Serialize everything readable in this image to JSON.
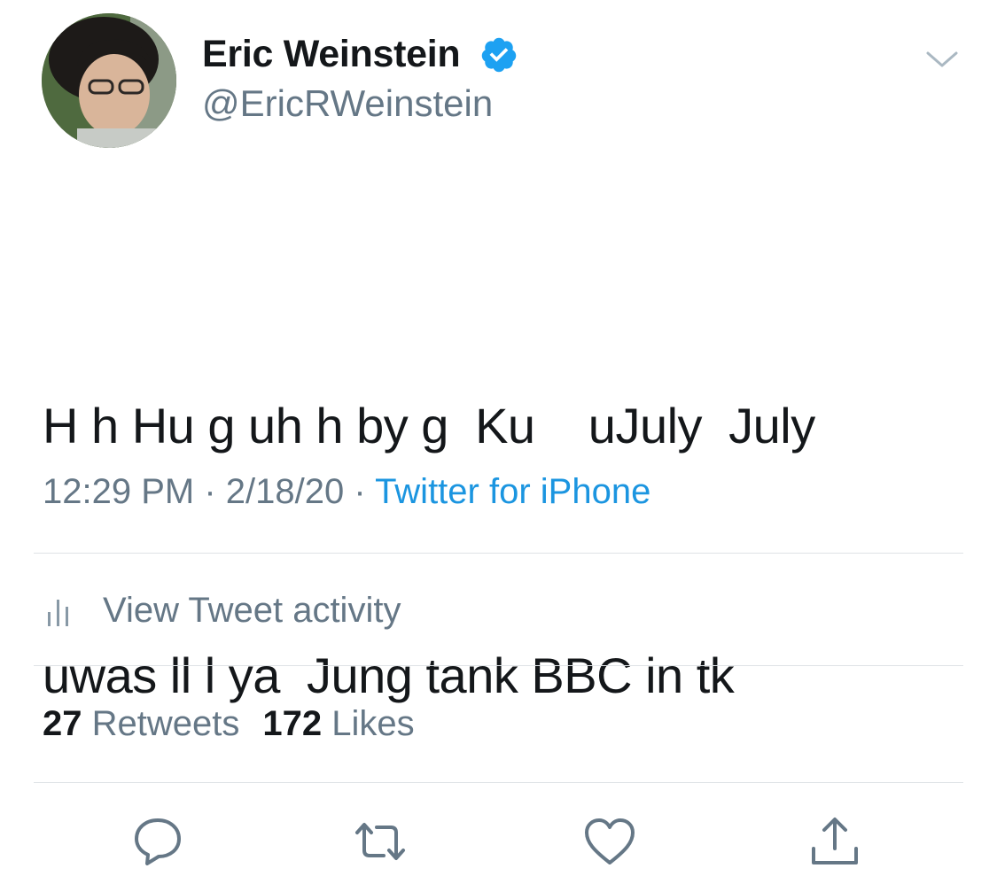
{
  "author": {
    "display_name": "Eric Weinstein",
    "handle": "@EricRWeinstein",
    "verified": true
  },
  "tweet": {
    "text_line1": "H h Hu g uh h by g  Ku    uJuly  July",
    "text_line2": "uwas ll l ya  Jung tank BBC in tk"
  },
  "meta": {
    "time": "12:29 PM",
    "sep1": " · ",
    "date": "2/18/20",
    "sep2": " · ",
    "source": "Twitter for iPhone"
  },
  "activity": {
    "label": "View Tweet activity"
  },
  "stats": {
    "retweets_count": "27",
    "retweets_label": "Retweets",
    "likes_count": "172",
    "likes_label": "Likes"
  },
  "icons": {
    "verified": "verified-badge-icon",
    "caret": "chevron-down-icon",
    "activity": "bar-chart-icon",
    "reply": "reply-icon",
    "retweet": "retweet-icon",
    "like": "heart-icon",
    "share": "share-icon"
  },
  "colors": {
    "text_primary": "#14171a",
    "text_secondary": "#657786",
    "link": "#1b95e0",
    "verified": "#1da1f2",
    "divider": "#dfe3e6"
  }
}
